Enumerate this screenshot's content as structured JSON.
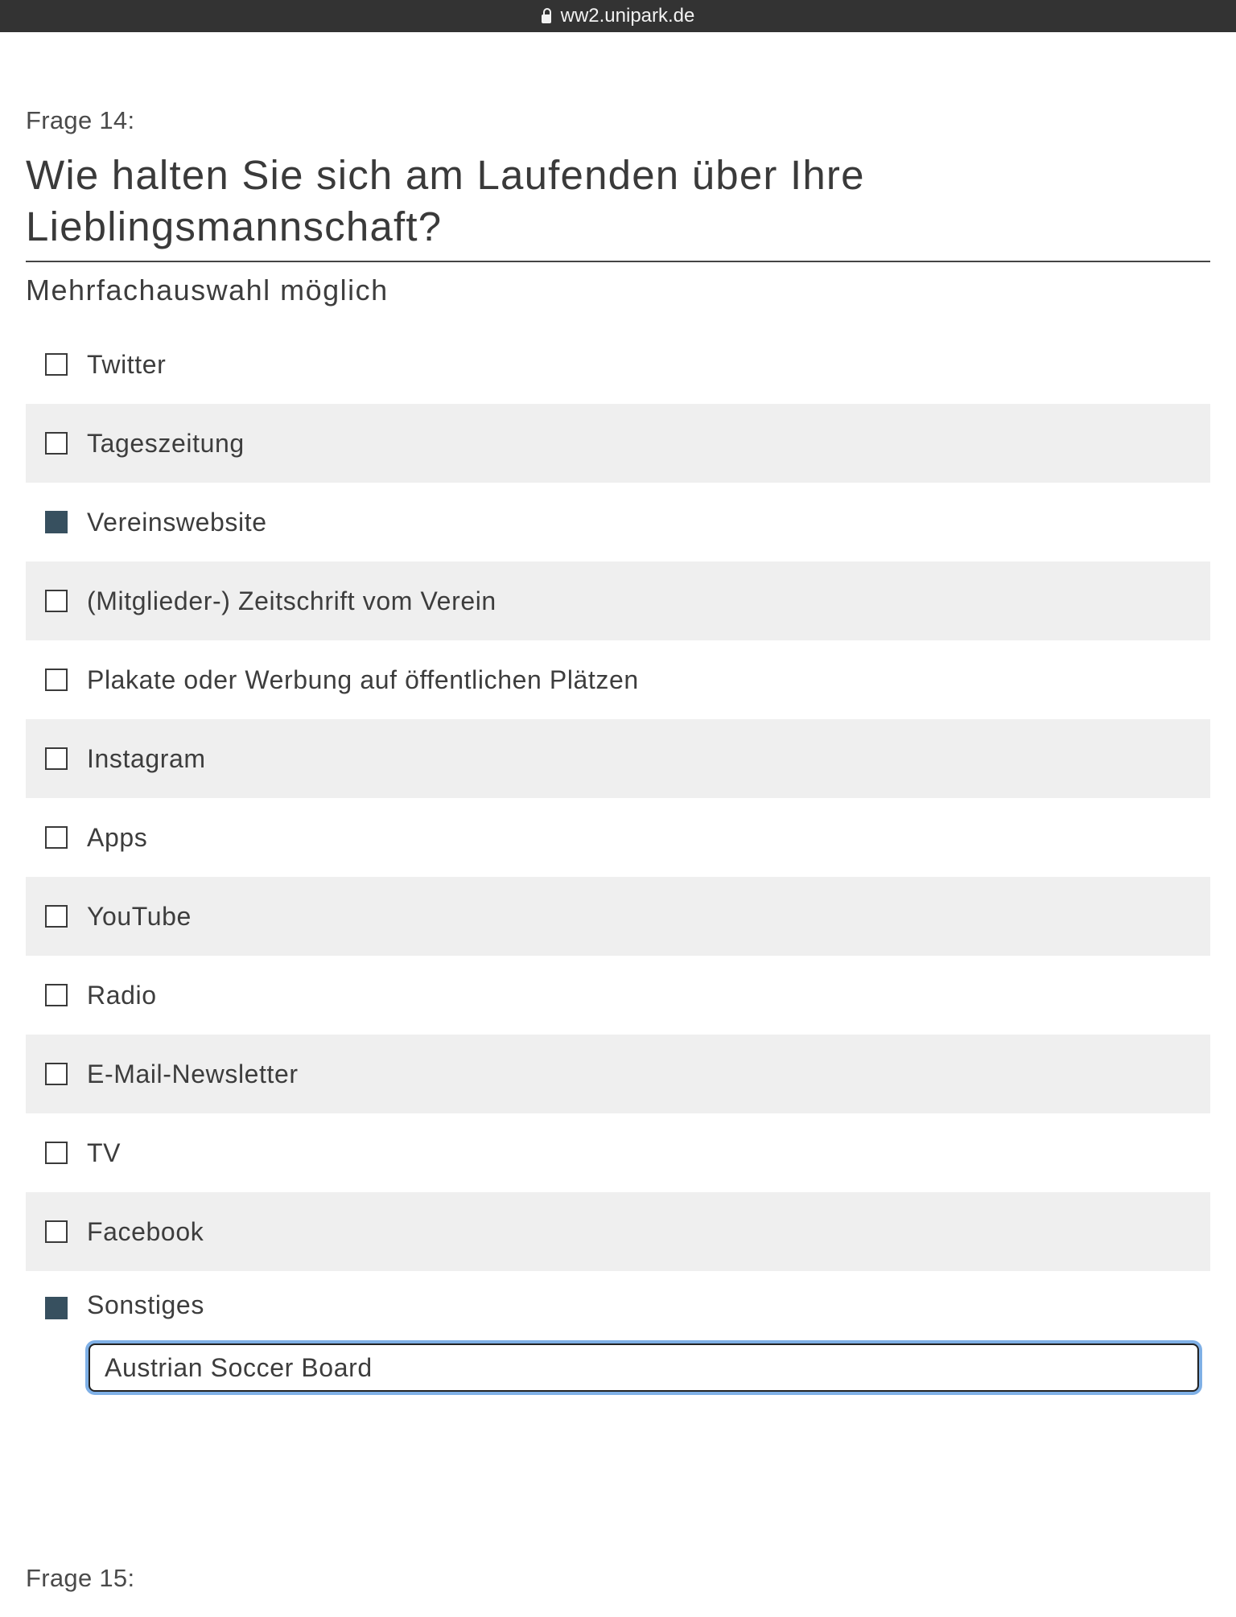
{
  "browser": {
    "url": "ww2.unipark.de"
  },
  "question": {
    "number": "Frage 14:",
    "title": "Wie halten Sie sich am Laufenden über Ihre Lieblingsmannschaft?",
    "hint": "Mehrfachauswahl möglich"
  },
  "options": [
    {
      "label": "Twitter",
      "checked": false
    },
    {
      "label": "Tageszeitung",
      "checked": false
    },
    {
      "label": "Vereinswebsite",
      "checked": true
    },
    {
      "label": "(Mitglieder-) Zeitschrift vom Verein",
      "checked": false
    },
    {
      "label": "Plakate oder Werbung auf öffentlichen Plätzen",
      "checked": false
    },
    {
      "label": "Instagram",
      "checked": false
    },
    {
      "label": "Apps",
      "checked": false
    },
    {
      "label": "YouTube",
      "checked": false
    },
    {
      "label": "Radio",
      "checked": false
    },
    {
      "label": "E-Mail-Newsletter",
      "checked": false
    },
    {
      "label": "TV",
      "checked": false
    },
    {
      "label": "Facebook",
      "checked": false
    },
    {
      "label": "Sonstiges",
      "checked": true,
      "other_value": "Austrian Soccer Board"
    }
  ],
  "next_question": {
    "number": "Frage 15:"
  },
  "colors": {
    "checked_fill": "#37505f",
    "alt_row": "#efefef",
    "focus_ring": "#7fb0e6",
    "urlbar_bg": "#333333"
  }
}
